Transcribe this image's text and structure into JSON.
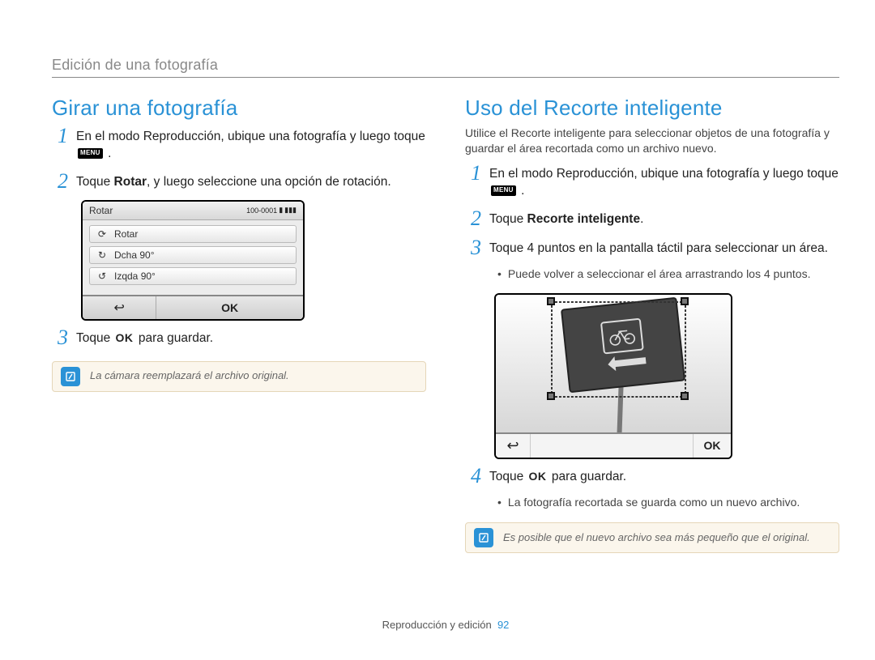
{
  "breadcrumb": "Edición de una fotografía",
  "left": {
    "heading": "Girar una fotografía",
    "step1": "En el modo Reproducción, ubique una fotografía y luego toque ",
    "step2_a": "Toque ",
    "step2_bold": "Rotar",
    "step2_b": ", y luego seleccione una opción de rotación.",
    "step3_a": "Toque ",
    "ok_label": "OK",
    "step3_b": " para guardar.",
    "callout": "La cámara reemplazará el archivo original.",
    "rotate_screen": {
      "title": "Rotar",
      "counter": "100-0001",
      "items": [
        "Rotar",
        "Dcha 90°",
        "Izqda 90°"
      ],
      "ok": "OK"
    }
  },
  "right": {
    "heading": "Uso del Recorte inteligente",
    "intro": "Utilice el Recorte inteligente para seleccionar objetos de una fotografía y guardar el área recortada como un archivo nuevo.",
    "step1": "En el modo Reproducción, ubique una fotografía y luego toque ",
    "step2_a": "Toque ",
    "step2_bold": "Recorte inteligente",
    "step2_b": ".",
    "step3": "Toque 4 puntos en la pantalla táctil para seleccionar un área.",
    "step3_bullet": "Puede volver a seleccionar el área arrastrando los 4 puntos.",
    "step4_a": "Toque ",
    "ok_label": "OK",
    "step4_b": " para guardar.",
    "step4_bullet": "La fotografía recortada se guarda como un nuevo archivo.",
    "callout": "Es posible que el nuevo archivo sea más pequeño que el original.",
    "crop_screen": {
      "ok": "OK"
    }
  },
  "footer": {
    "section": "Reproducción y edición",
    "page": "92"
  },
  "menu_label": "MENU"
}
